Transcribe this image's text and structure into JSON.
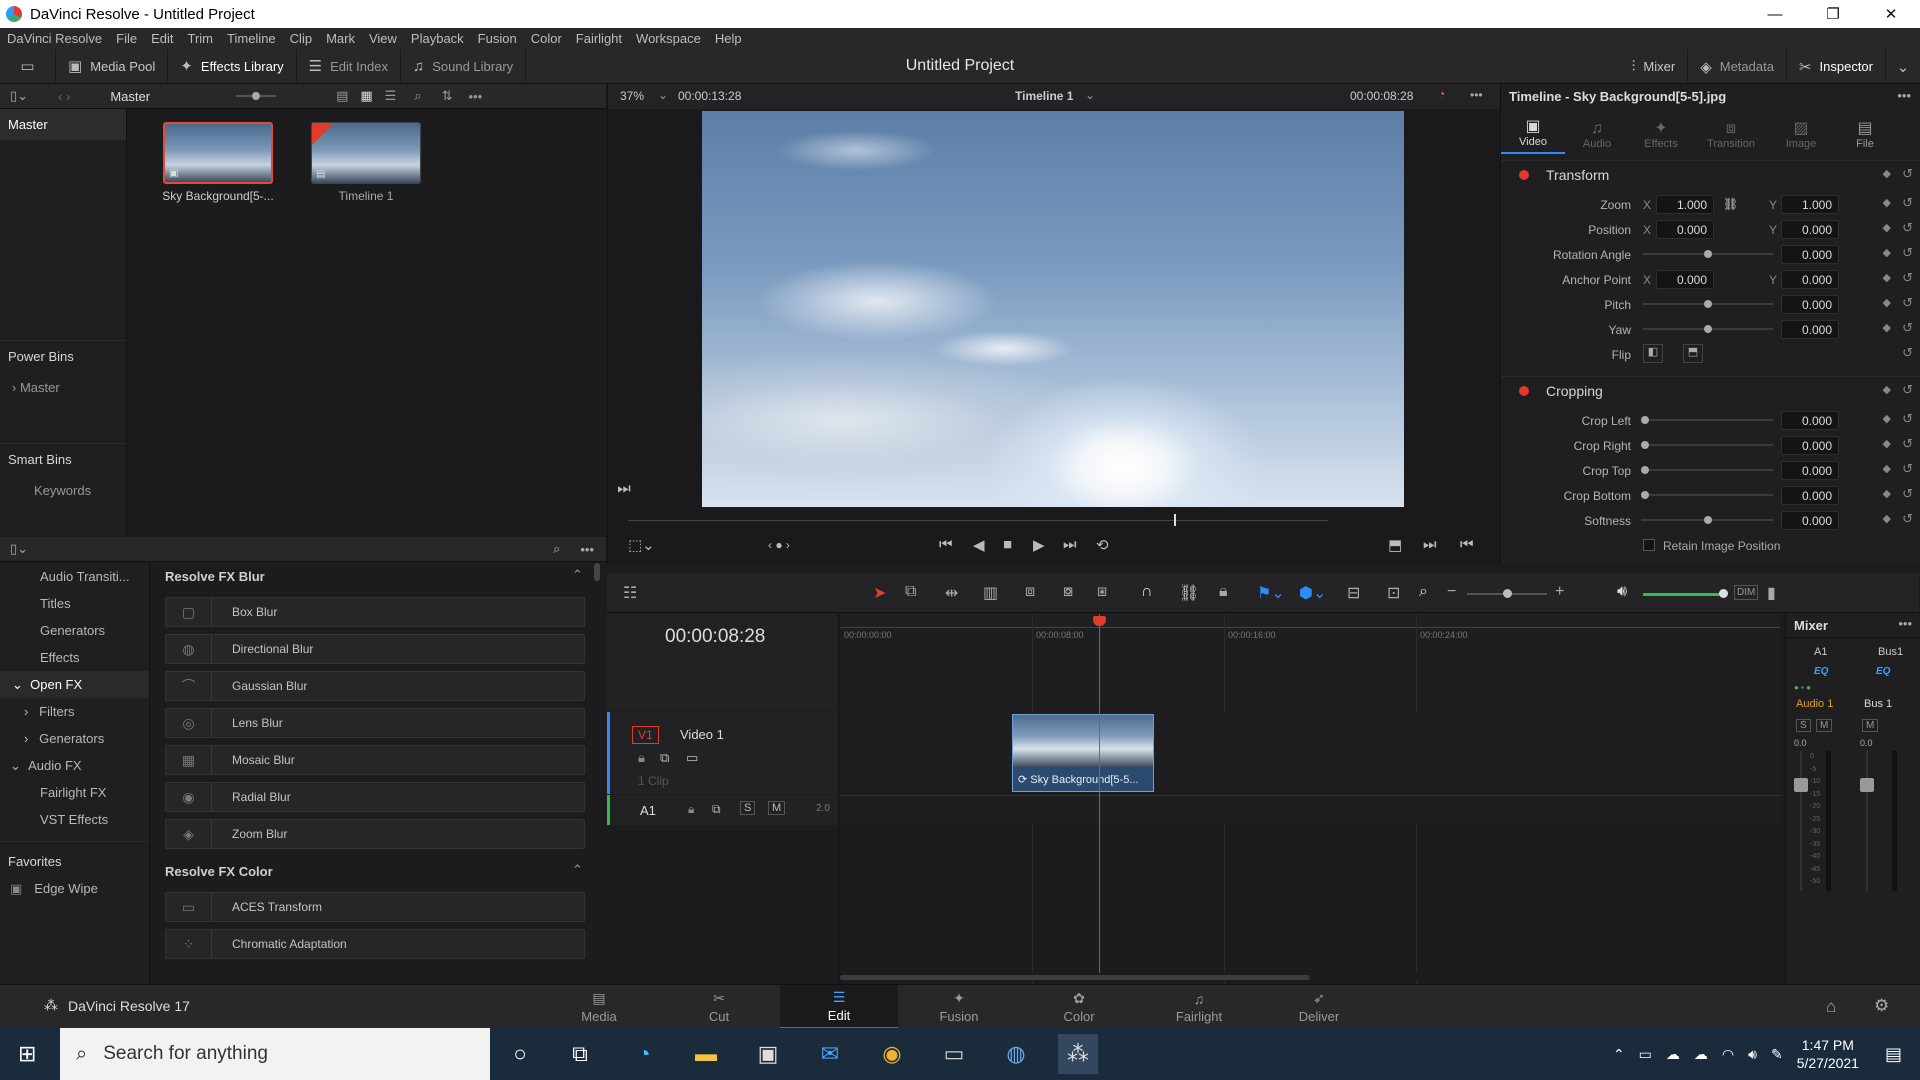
{
  "window": {
    "title": "DaVinci Resolve - Untitled Project",
    "minimize": "—",
    "restore": "❐",
    "close": "✕"
  },
  "menu": [
    "DaVinci Resolve",
    "File",
    "Edit",
    "Trim",
    "Timeline",
    "Clip",
    "Mark",
    "View",
    "Playback",
    "Fusion",
    "Color",
    "Fairlight",
    "Workspace",
    "Help"
  ],
  "toolbar": {
    "media_pool": "Media Pool",
    "effects_library": "Effects Library",
    "edit_index": "Edit Index",
    "sound_library": "Sound Library",
    "project_title": "Untitled Project",
    "mixer": "Mixer",
    "metadata": "Metadata",
    "inspector": "Inspector"
  },
  "media_pool": {
    "bin_header": "Master",
    "bins": [
      "Master"
    ],
    "power_bins_title": "Power Bins",
    "power_bins": [
      "Master"
    ],
    "smart_bins_title": "Smart Bins",
    "smart_bins": [
      "Keywords"
    ],
    "clips": [
      {
        "name": "Sky Background[5-..."
      },
      {
        "name": "Timeline 1"
      }
    ]
  },
  "effects": {
    "categories": [
      {
        "label": "Audio Transiti..."
      },
      {
        "label": "Titles"
      },
      {
        "label": "Generators"
      },
      {
        "label": "Effects"
      },
      {
        "label": "Open FX"
      },
      {
        "label": "Filters"
      },
      {
        "label": "Generators"
      },
      {
        "label": "Audio FX"
      },
      {
        "label": "Fairlight FX"
      },
      {
        "label": "VST Effects"
      }
    ],
    "favorites_title": "Favorites",
    "favorites": [
      "Edge Wipe"
    ],
    "group1_title": "Resolve FX Blur",
    "group1": [
      "Box Blur",
      "Directional Blur",
      "Gaussian Blur",
      "Lens Blur",
      "Mosaic Blur",
      "Radial Blur",
      "Zoom Blur"
    ],
    "group2_title": "Resolve FX Color",
    "group2": [
      "ACES Transform",
      "Chromatic Adaptation"
    ]
  },
  "viewer": {
    "zoom": "37%",
    "source_tc": "00:00:13:28",
    "timeline_name": "Timeline 1",
    "record_tc": "00:00:08:28"
  },
  "inspector": {
    "title": "Timeline - Sky Background[5-5].jpg",
    "tabs": [
      "Video",
      "Audio",
      "Effects",
      "Transition",
      "Image",
      "File"
    ],
    "transform_title": "Transform",
    "zoom_label": "Zoom",
    "zoom_x": "1.000",
    "zoom_y": "1.000",
    "position_label": "Position",
    "position_x": "0.000",
    "position_y": "0.000",
    "rotation_label": "Rotation Angle",
    "rotation": "0.000",
    "anchor_label": "Anchor Point",
    "anchor_x": "0.000",
    "anchor_y": "0.000",
    "pitch_label": "Pitch",
    "pitch": "0.000",
    "yaw_label": "Yaw",
    "yaw": "0.000",
    "flip_label": "Flip",
    "cropping_title": "Cropping",
    "crop_left_label": "Crop Left",
    "crop_left": "0.000",
    "crop_right_label": "Crop Right",
    "crop_right": "0.000",
    "crop_top_label": "Crop Top",
    "crop_top": "0.000",
    "crop_bottom_label": "Crop Bottom",
    "crop_bottom": "0.000",
    "softness_label": "Softness",
    "softness": "0.000",
    "retain_label": "Retain Image Position",
    "x": "X",
    "y": "Y"
  },
  "timeline": {
    "timecode": "00:00:08:28",
    "ruler": [
      "00:00:00:00",
      "00:00:08:00",
      "00:00:16:00",
      "00:00:24:00"
    ],
    "video_track": {
      "id": "V1",
      "name": "Video 1",
      "clips": "1 Clip"
    },
    "audio_track": {
      "id": "A1",
      "level": "2.0",
      "s": "S",
      "m": "M"
    },
    "clip_name": "Sky Background[5-5..."
  },
  "mixer": {
    "title": "Mixer",
    "ch1": "A1",
    "ch2": "Bus1",
    "eq": "EQ",
    "ch1_name": "Audio 1",
    "ch2_name": "Bus 1",
    "s": "S",
    "m": "M",
    "db1": "0.0",
    "db2": "0.0",
    "scale": [
      "0",
      "-5",
      "-10",
      "-15",
      "-20",
      "-25",
      "-30",
      "-35",
      "-40",
      "-45",
      "-50"
    ]
  },
  "pages": [
    "Media",
    "Cut",
    "Edit",
    "Fusion",
    "Color",
    "Fairlight",
    "Deliver"
  ],
  "app_version": "DaVinci Resolve 17",
  "taskbar": {
    "search_placeholder": "Search for anything",
    "time": "1:47 PM",
    "date": "5/27/2021"
  },
  "colors": {
    "accent_red": "#e33a2a",
    "accent_blue": "#2e8aff",
    "playhead": "#e33a2a"
  }
}
